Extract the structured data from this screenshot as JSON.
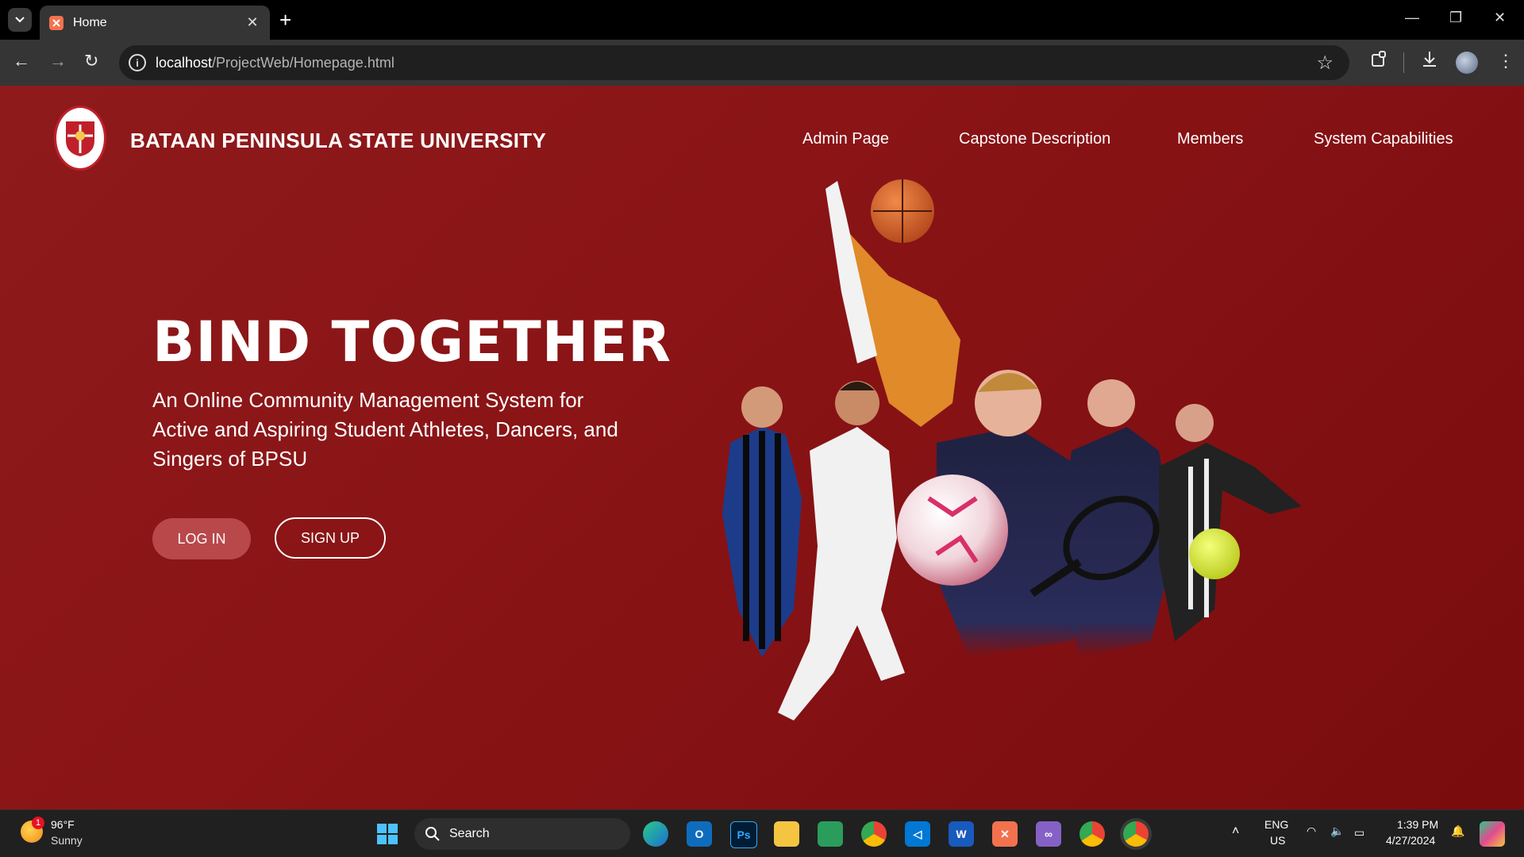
{
  "browser": {
    "tab_title": "Home",
    "url_host": "localhost",
    "url_path": "/ProjectWeb/Homepage.html"
  },
  "header": {
    "brand": "BATAAN PENINSULA STATE UNIVERSITY",
    "nav": [
      "Admin Page",
      "Capstone Description",
      "Members",
      "System Capabilities"
    ]
  },
  "hero": {
    "title": "BIND TOGETHER",
    "subtitle": "An Online Community Management System for Active and Aspiring Student Athletes, Dancers, and Singers of BPSU",
    "login_label": "LOG IN",
    "signup_label": "SIGN UP"
  },
  "taskbar": {
    "weather_temp": "96°F",
    "weather_cond": "Sunny",
    "weather_badge": "1",
    "search_label": "Search",
    "lang_top": "ENG",
    "lang_bottom": "US",
    "time": "1:39 PM",
    "date": "4/27/2024"
  },
  "colors": {
    "page_bg": "#8a1416",
    "login_button": "#b9484a"
  }
}
